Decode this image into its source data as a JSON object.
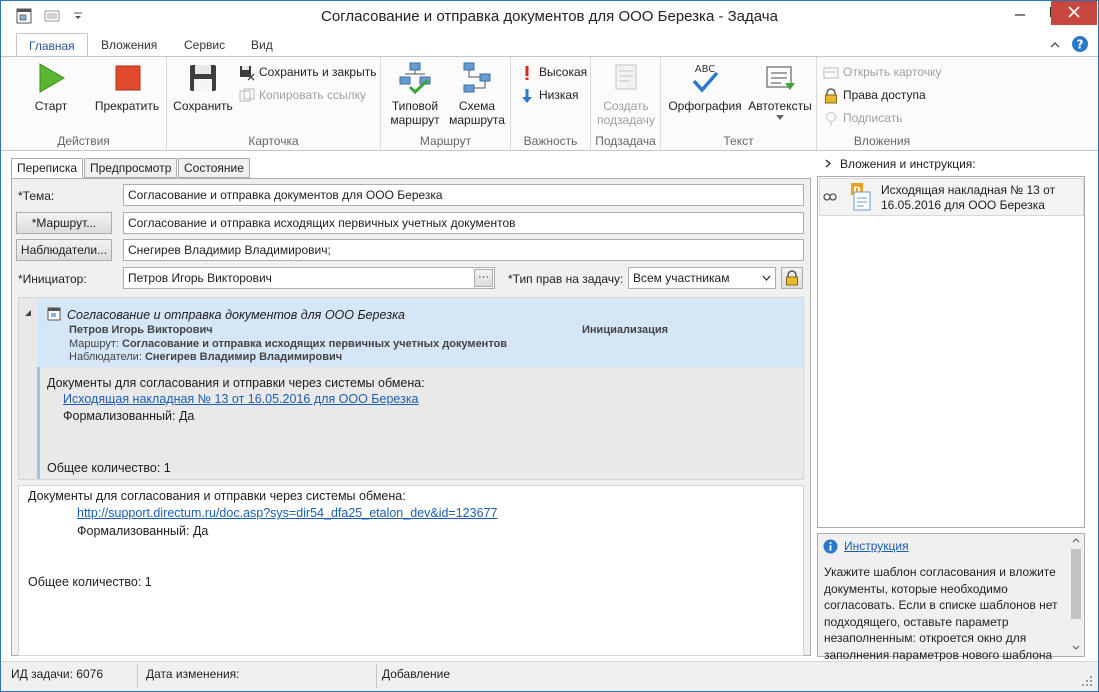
{
  "window": {
    "title": "Согласование и отправка документов для ООО Березка - Задача"
  },
  "ribbon": {
    "tabs": [
      "Главная",
      "Вложения",
      "Сервис",
      "Вид"
    ],
    "groups": {
      "actions": {
        "label": "Действия",
        "start": "Старт",
        "stop": "Прекратить"
      },
      "card": {
        "label": "Карточка",
        "save": "Сохранить",
        "save_close": "Сохранить и закрыть",
        "copy_link": "Копировать ссылку"
      },
      "route": {
        "label": "Маршрут",
        "typical_1": "Типовой",
        "typical_2": "маршрут",
        "scheme_1": "Схема",
        "scheme_2": "маршрута"
      },
      "importance": {
        "label": "Важность",
        "high": "Высокая",
        "low": "Низкая"
      },
      "subtask": {
        "label": "Подзадача",
        "create_1": "Создать",
        "create_2": "подзадачу"
      },
      "text": {
        "label": "Текст",
        "spelling": "Орфография",
        "autotext": "Автотексты",
        "abc": "ABC"
      },
      "attachments": {
        "label": "Вложения",
        "open_card": "Открыть карточку",
        "access": "Права доступа",
        "sign": "Подписать"
      }
    }
  },
  "content_tabs": [
    "Переписка",
    "Предпросмотр",
    "Состояние"
  ],
  "form": {
    "subject_label": "*Тема:",
    "subject_value": "Согласование и отправка документов для ООО Березка",
    "route_button": "*Маршрут...",
    "route_value": "Согласование и отправка исходящих первичных учетных документов",
    "observers_button": "Наблюдатели...",
    "observers_value": "Снегирев Владимир Владимирович;",
    "initiator_label": "*Инициатор:",
    "initiator_value": "Петров Игорь Викторович",
    "initiator_btn": "···",
    "rights_label": "*Тип прав на задачу:",
    "rights_value": "Всем участникам"
  },
  "message": {
    "title": "Согласование и отправка документов для ООО Березка",
    "author": "Петров Игорь Викторович",
    "stage": "Инициализация",
    "route_label": "Маршрут:",
    "route_value": "Согласование и отправка исходящих первичных учетных документов",
    "observers_label": "Наблюдатели:",
    "observers_value": "Снегирев Владимир Владимирович",
    "body_line1": "Документы для согласования и отправки через системы обмена:",
    "body_link": "Исходящая накладная № 13 от 16.05.2016 для ООО Березка",
    "body_line3": "Формализованный: Да",
    "body_total": "Общее количество: 1"
  },
  "editor": {
    "line1": "Документы для согласования и отправки через системы обмена:",
    "link": "http://support.directum.ru/doc.asp?sys=dir54_dfa25_etalon_dev&id=123677",
    "line3": "Формализованный: Да",
    "total": "Общее количество: 1"
  },
  "right_pane": {
    "title": "Вложения и инструкция:",
    "attachment_line1": "Исходящая накладная № 13 от",
    "attachment_line2": "16.05.2016 для ООО Березка",
    "instruction_link": "Инструкция",
    "instruction_text": "Укажите шаблон согласования и вложите документы, которые необходимо согласовать. Если в списке шаблонов нет подходящего, оставьте параметр незаполненным: откроется окно для заполнения параметров нового шаблона"
  },
  "status": {
    "task_id": "ИД задачи: 6076",
    "modified": "Дата изменения:",
    "mode": "Добавление"
  },
  "colors": {
    "accent": "#2b579a",
    "start_green": "#5cb531",
    "stop_red": "#e0492b",
    "message_header": "#d5e6f6",
    "close_red": "#c7463e"
  }
}
